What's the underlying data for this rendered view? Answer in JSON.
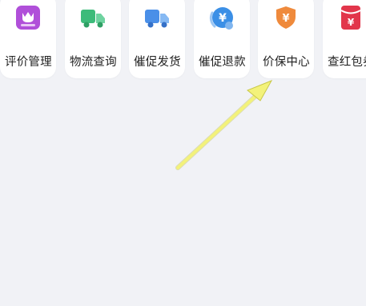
{
  "shortcuts": [
    {
      "label": "评价管理",
      "icon": "review-icon",
      "color": "#b04fd9"
    },
    {
      "label": "物流查询",
      "icon": "truck-icon",
      "color": "#3dbb7a"
    },
    {
      "label": "催促发货",
      "icon": "truck-icon",
      "color": "#4a8fe8"
    },
    {
      "label": "催促退款",
      "icon": "refund-icon",
      "color": "#3b8fe6",
      "glyph": "¥"
    },
    {
      "label": "价保中心",
      "icon": "shield-icon",
      "color": "#ef8a3c",
      "glyph": "¥"
    },
    {
      "label": "查红包券",
      "icon": "red-packet-icon",
      "color": "#e2364b",
      "glyph": "¥"
    }
  ],
  "annotation": {
    "color": "#f3f27a"
  }
}
